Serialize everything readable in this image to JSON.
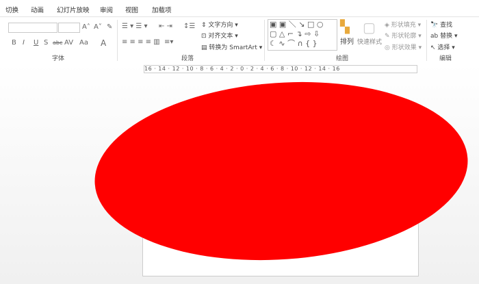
{
  "tabs": [
    "切换",
    "动画",
    "幻灯片放映",
    "审阅",
    "视图",
    "加载项"
  ],
  "font_group": {
    "label": "字体",
    "font_name": "",
    "font_size": "",
    "buttons": [
      "B",
      "I",
      "U",
      "S",
      "abc",
      "AV",
      "Aa",
      "A"
    ]
  },
  "paragraph_group": {
    "label": "段落",
    "text_direction": "文字方向",
    "align_text": "对齐文本",
    "convert_smartart": "转换为 SmartArt"
  },
  "drawing_group": {
    "label": "绘图",
    "arrange": "排列",
    "quick_styles": "快速样式",
    "shape_fill": "形状填充",
    "shape_outline": "形状轮廓",
    "shape_effects": "形状效果"
  },
  "editing_group": {
    "label": "编辑",
    "find": "查找",
    "replace": "替换",
    "select": "选择"
  },
  "ruler": "16 · 14 · 12 · 10 · 8 · 6 · 4 · 2 · 0 · 2 · 4 · 6 · 8 · 10 · 12 · 14 · 16",
  "shape": {
    "type": "ellipse",
    "fill": "#ff0000"
  }
}
